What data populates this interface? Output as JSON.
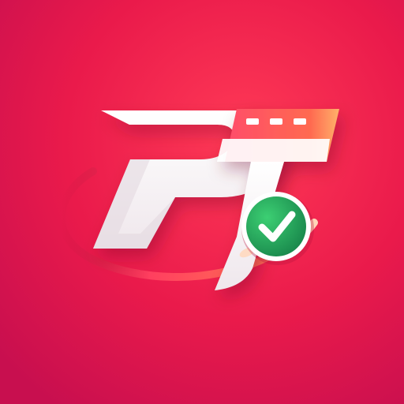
{
  "logo": {
    "monogram": "PT",
    "icon": "check-badge-icon",
    "colors": {
      "background_top": "#f02048",
      "background_bottom": "#d7124a",
      "accent_pink": "#ff3b6a",
      "accent_orange": "#ff8a3d",
      "letter_white": "#f7f4f6",
      "badge_green": "#27a35a"
    }
  }
}
